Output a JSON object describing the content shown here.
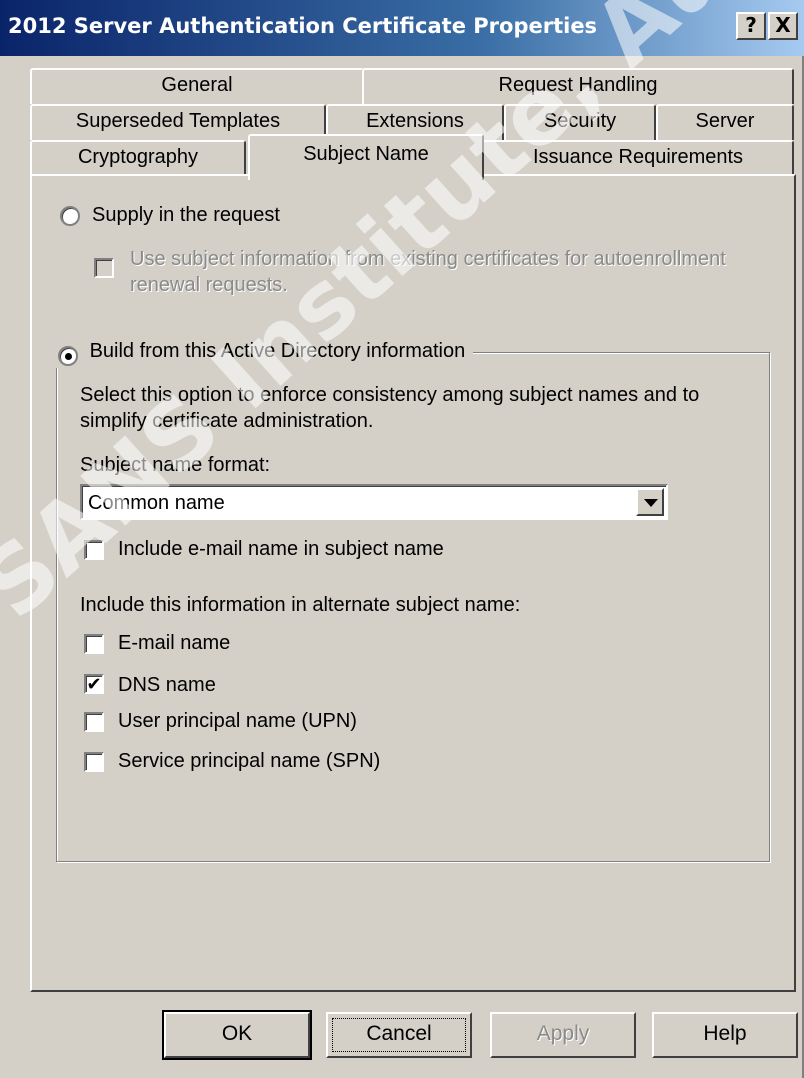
{
  "window": {
    "title": "2012 Server Authentication Certificate Properties",
    "help_label": "?",
    "close_label": "X"
  },
  "tabs": {
    "row1": [
      "General",
      "Request Handling"
    ],
    "row2": [
      "Superseded Templates",
      "Extensions",
      "Security",
      "Server"
    ],
    "row3": [
      "Cryptography",
      "Subject Name",
      "Issuance Requirements"
    ],
    "active": "Subject Name"
  },
  "subject": {
    "supply_label": "Supply in the request",
    "supply_selected": false,
    "use_existing_line1": "Use subject information from existing certificates for autoenrollment",
    "use_existing_line2": "renewal requests.",
    "build_label": "Build from this Active Directory information",
    "build_selected": true,
    "description_line1": "Select this option to enforce consistency among subject names and to",
    "description_line2": "simplify certificate administration.",
    "format_label": "Subject name format:",
    "format_value": "Common name",
    "include_email_label": "Include e-mail name in subject name",
    "include_email_checked": false,
    "alt_label": "Include this information in alternate subject name:",
    "alt_options": [
      {
        "label": "E-mail name",
        "checked": false
      },
      {
        "label": "DNS name",
        "checked": true
      },
      {
        "label": "User principal name (UPN)",
        "checked": false
      },
      {
        "label": "Service principal name (SPN)",
        "checked": false
      }
    ]
  },
  "buttons": {
    "ok": "OK",
    "cancel": "Cancel",
    "apply": "Apply",
    "help": "Help"
  },
  "watermark": "SANS Institute, Author retains"
}
